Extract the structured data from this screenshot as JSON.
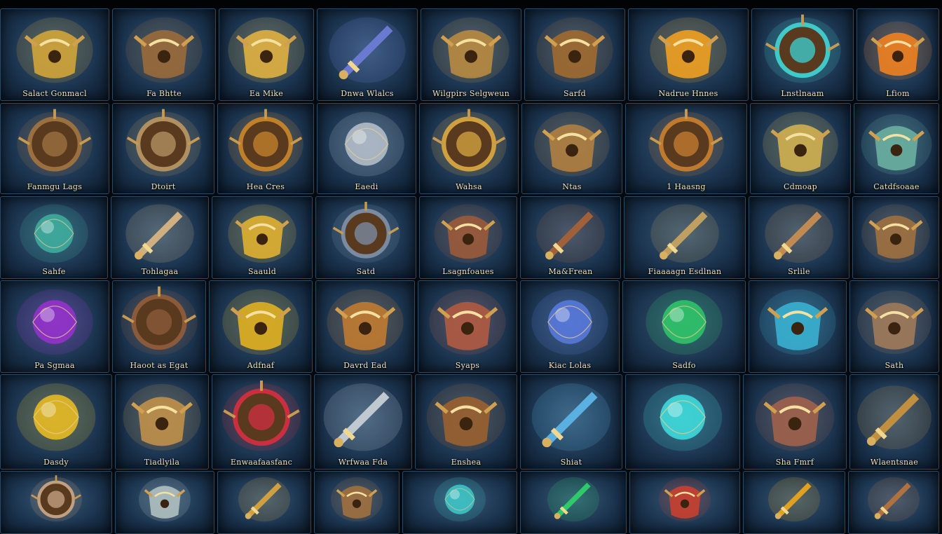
{
  "palette": {
    "gold": "#c9962f",
    "bronze": "#8a5a2b",
    "teal": "#3fc9c9",
    "purple": "#8e2fc9",
    "emerald": "#2fc96a",
    "ruby": "#c92f3f",
    "steel": "#b8c2cc",
    "amber": "#f0a020"
  },
  "rows": [
    [
      {
        "label": "Salact Gonmacl",
        "icon": "gold-relic-icon",
        "glow": "#d1a43a"
      },
      {
        "label": "Fa Bhtte",
        "icon": "bronze-pauldron-icon",
        "glow": "#9a6a3a"
      },
      {
        "label": "Ea Mike",
        "icon": "golden-chalice-icon",
        "glow": "#e0b040"
      },
      {
        "label": "Dnwa Wlalcs",
        "icon": "arcane-crossbow-icon",
        "glow": "#6a7ad0"
      },
      {
        "label": "Wilgpirs Selgweun",
        "icon": "brass-dragon-icon",
        "glow": "#b88a40"
      },
      {
        "label": "Sarfd",
        "icon": "bronze-gauntlet-icon",
        "glow": "#a06a30"
      },
      {
        "label": "Nadrue Hnnes",
        "icon": "flame-chest-icon",
        "glow": "#f0a020"
      },
      {
        "label": "Lnstlnaam",
        "icon": "teal-crest-icon",
        "glow": "#3fc9c9"
      },
      {
        "label": "Lfiom",
        "icon": "ember-helm-icon",
        "glow": "#f08020"
      }
    ],
    [
      {
        "label": "Fanmgu Lags",
        "icon": "round-shield-icon",
        "glow": "#9a7040"
      },
      {
        "label": "Dtoirt",
        "icon": "scarab-medallion-icon",
        "glow": "#b09060"
      },
      {
        "label": "Hea Cres",
        "icon": "gilded-wreath-icon",
        "glow": "#c0802a"
      },
      {
        "label": "Eaedi",
        "icon": "steel-orb-icon",
        "glow": "#b8c2cc"
      },
      {
        "label": "Wahsa",
        "icon": "clockwork-compass-icon",
        "glow": "#d0a040"
      },
      {
        "label": "Ntas",
        "icon": "brass-idol-icon",
        "glow": "#b08040"
      },
      {
        "label": "1 Haasng",
        "icon": "ornate-frame-icon",
        "glow": "#c07a30"
      },
      {
        "label": "Cdmoap",
        "icon": "golden-lily-icon",
        "glow": "#d0b050"
      },
      {
        "label": "Catdfsoaae",
        "icon": "jewel-cluster-icon",
        "glow": "#6ab0a0"
      }
    ],
    [
      {
        "label": "Sahfe",
        "icon": "emerald-amulet-icon",
        "glow": "#3fb0a0"
      },
      {
        "label": "Tohlagaa",
        "icon": "crossed-blades-icon",
        "glow": "#d0b080"
      },
      {
        "label": "Saauld",
        "icon": "gold-nugget-icon",
        "glow": "#e0b030"
      },
      {
        "label": "Satd",
        "icon": "winged-shield-icon",
        "glow": "#7a8aa0"
      },
      {
        "label": "Lsagnfoaues",
        "icon": "iron-anvil-icon",
        "glow": "#9a5a3a"
      },
      {
        "label": "Ma&Frean",
        "icon": "horned-chest-icon",
        "glow": "#a0603a"
      },
      {
        "label": "Fiaaaagn Esdlnan",
        "icon": "golden-horn-icon",
        "glow": "#c0a060"
      },
      {
        "label": "Srlile",
        "icon": "war-drill-icon",
        "glow": "#c08a50"
      },
      {
        "label": "",
        "icon": "bronze-cannon-icon",
        "glow": "#a07040"
      }
    ],
    [
      {
        "label": "Pa Sgmaa",
        "icon": "amethyst-crystal-icon",
        "glow": "#9a30d0"
      },
      {
        "label": "Haoot as Egat",
        "icon": "leather-shield-icon",
        "glow": "#8a5a3a"
      },
      {
        "label": "Adfnaf",
        "icon": "golden-gauntlet-icon",
        "glow": "#e0b020"
      },
      {
        "label": "Davrd Ead",
        "icon": "gilded-armor-icon",
        "glow": "#c07a30"
      },
      {
        "label": "Syaps",
        "icon": "copper-chestplate-icon",
        "glow": "#b05a40"
      },
      {
        "label": "Kiac Lolas",
        "icon": "sapphire-gem-icon",
        "glow": "#5a7ae0"
      },
      {
        "label": "Sadfo",
        "icon": "emerald-shard-icon",
        "glow": "#2fc96a"
      },
      {
        "label": "",
        "icon": "frost-key-icon",
        "glow": "#3ab0d0"
      },
      {
        "label": "Sath",
        "icon": "war-mask-icon",
        "glow": "#a07a5a"
      }
    ],
    [
      {
        "label": "Dasdy",
        "icon": "amber-orb-icon",
        "glow": "#f0c020"
      },
      {
        "label": "Tiadlyila",
        "icon": "gold-filigree-icon",
        "glow": "#c0904a"
      },
      {
        "label": "Enwaafaasfanc",
        "icon": "ruby-emblem-icon",
        "glow": "#c92f3f"
      },
      {
        "label": "Wrfwaa Fda",
        "icon": "steel-spear-icon",
        "glow": "#c0c8d0"
      },
      {
        "label": "Enshea",
        "icon": "bronze-beast-icon",
        "glow": "#9a6030"
      },
      {
        "label": "Shiat",
        "icon": "frost-sword-icon",
        "glow": "#5ab0e0"
      },
      {
        "label": "",
        "icon": "lightning-crystal-icon",
        "glow": "#3fe0e0"
      },
      {
        "label": "Sha Fmrf",
        "icon": "copper-urn-icon",
        "glow": "#a0604a"
      },
      {
        "label": "Wlaentsnae",
        "icon": "brass-rifle-icon",
        "glow": "#c09040"
      }
    ],
    [
      {
        "label": "",
        "icon": "ivory-crest-icon",
        "glow": "#c0a080"
      },
      {
        "label": "",
        "icon": "silver-wing-icon",
        "glow": "#b0c0c0"
      },
      {
        "label": "",
        "icon": "gold-bow-icon",
        "glow": "#d0a040"
      },
      {
        "label": "",
        "icon": "bronze-relic-icon",
        "glow": "#a07040"
      },
      {
        "label": "",
        "icon": "teal-spirit-icon",
        "glow": "#3fc9c9"
      },
      {
        "label": "",
        "icon": "jade-sword-icon",
        "glow": "#2fc96a"
      },
      {
        "label": "",
        "icon": "crimson-banner-icon",
        "glow": "#c93f2f"
      },
      {
        "label": "",
        "icon": "amber-wand-icon",
        "glow": "#e0a020"
      },
      {
        "label": "",
        "icon": "bronze-scepter-icon",
        "glow": "#b07040"
      }
    ]
  ]
}
